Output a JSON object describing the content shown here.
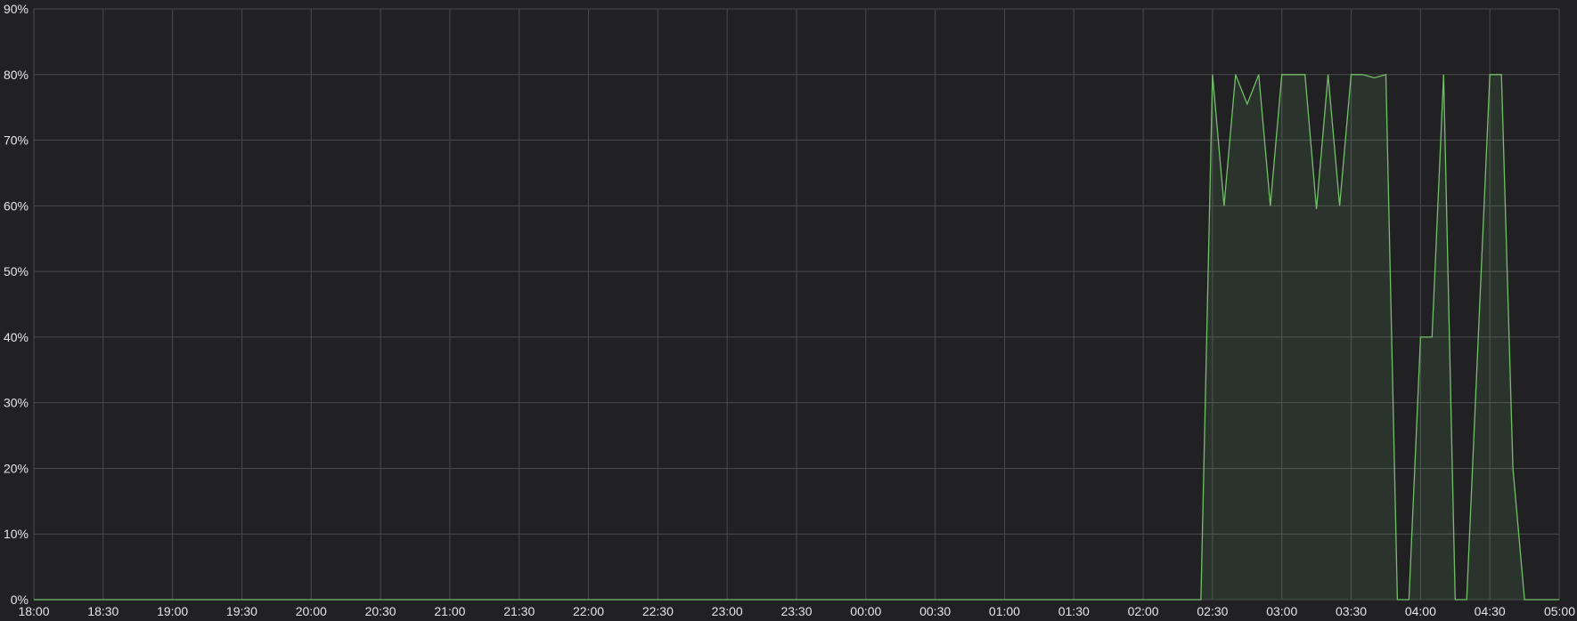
{
  "chart_data": {
    "type": "area",
    "title": "",
    "xlabel": "",
    "ylabel": "",
    "grid": true,
    "legend": "none",
    "x_tick_labels": [
      "18:00",
      "18:30",
      "19:00",
      "19:30",
      "20:00",
      "20:30",
      "21:00",
      "21:30",
      "22:00",
      "22:30",
      "23:00",
      "23:30",
      "00:00",
      "00:30",
      "01:00",
      "01:30",
      "02:00",
      "02:30",
      "03:00",
      "03:30",
      "04:00",
      "04:30",
      "05:00"
    ],
    "y_tick_labels": [
      "0%",
      "10%",
      "20%",
      "30%",
      "40%",
      "50%",
      "60%",
      "70%",
      "80%",
      "90%"
    ],
    "y_ticks": [
      0,
      10,
      20,
      30,
      40,
      50,
      60,
      70,
      80,
      90
    ],
    "ylim": [
      0,
      90
    ],
    "xlim": [
      "18:00",
      "05:00"
    ],
    "series": [
      {
        "color": "#73bf69",
        "points": [
          [
            "18:00",
            0
          ],
          [
            "02:25",
            0
          ],
          [
            "02:30",
            80
          ],
          [
            "02:35",
            60
          ],
          [
            "02:40",
            80
          ],
          [
            "02:45",
            75.5
          ],
          [
            "02:50",
            80
          ],
          [
            "02:55",
            60
          ],
          [
            "03:00",
            80
          ],
          [
            "03:05",
            80
          ],
          [
            "03:10",
            80
          ],
          [
            "03:15",
            59.5
          ],
          [
            "03:20",
            80
          ],
          [
            "03:25",
            60
          ],
          [
            "03:30",
            80
          ],
          [
            "03:35",
            80
          ],
          [
            "03:40",
            79.5
          ],
          [
            "03:45",
            80
          ],
          [
            "03:50",
            0
          ],
          [
            "03:55",
            0
          ],
          [
            "04:00",
            40
          ],
          [
            "04:05",
            40
          ],
          [
            "04:10",
            80
          ],
          [
            "04:15",
            0
          ],
          [
            "04:20",
            0
          ],
          [
            "04:25",
            40
          ],
          [
            "04:30",
            80
          ],
          [
            "04:35",
            80
          ],
          [
            "04:40",
            20
          ],
          [
            "04:45",
            0
          ],
          [
            "05:00",
            0
          ]
        ]
      }
    ]
  }
}
